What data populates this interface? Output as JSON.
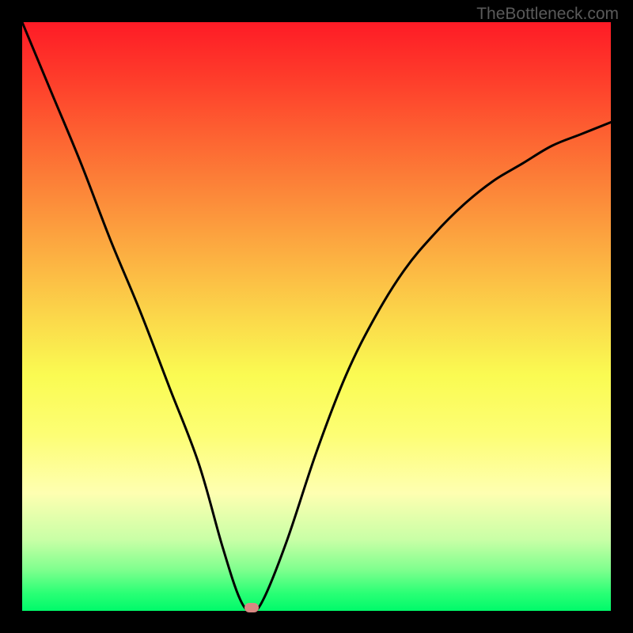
{
  "watermark": "TheBottleneck.com",
  "chart_data": {
    "type": "line",
    "title": "",
    "xlabel": "",
    "ylabel": "",
    "xlim": [
      0,
      1
    ],
    "ylim": [
      0,
      1
    ],
    "background": "rainbow-gradient-vertical",
    "series": [
      {
        "name": "bottleneck-curve",
        "type": "line",
        "x": [
          0.0,
          0.05,
          0.1,
          0.15,
          0.2,
          0.25,
          0.3,
          0.34,
          0.37,
          0.39,
          0.41,
          0.45,
          0.5,
          0.55,
          0.6,
          0.65,
          0.7,
          0.75,
          0.8,
          0.85,
          0.9,
          0.95,
          1.0
        ],
        "y": [
          1.0,
          0.88,
          0.76,
          0.63,
          0.51,
          0.38,
          0.25,
          0.11,
          0.02,
          0.0,
          0.02,
          0.12,
          0.27,
          0.4,
          0.5,
          0.58,
          0.64,
          0.69,
          0.73,
          0.76,
          0.79,
          0.81,
          0.83
        ]
      }
    ],
    "marker": {
      "x": 0.39,
      "y": 0.0,
      "color": "#d88882"
    },
    "gradient_stops": [
      {
        "pos": 0.0,
        "color": "#fe1b26"
      },
      {
        "pos": 0.25,
        "color": "#fc8b3a"
      },
      {
        "pos": 0.5,
        "color": "#fbd74a"
      },
      {
        "pos": 0.75,
        "color": "#feffb1"
      },
      {
        "pos": 1.0,
        "color": "#00fa6a"
      }
    ]
  }
}
